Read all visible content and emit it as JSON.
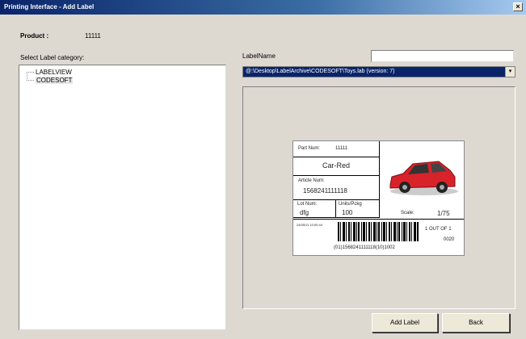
{
  "window": {
    "title": "Printing Interface - Add Label",
    "close_glyph": "×"
  },
  "product": {
    "label": "Product :",
    "value": "11111"
  },
  "category": {
    "label": "Select Label category:",
    "items": [
      {
        "label": "LABELVIEW",
        "selected": false
      },
      {
        "label": "CODESOFT",
        "selected": true
      }
    ]
  },
  "label_name": {
    "label": "LabelName",
    "value": ""
  },
  "label_path": {
    "value": "@:\\Desktop\\LabelArchive\\CODESOFT\\Toys.lab (version: 7)",
    "arrow_glyph": "▾"
  },
  "preview": {
    "part_num_label": "Part Num:",
    "part_num_value": "11111",
    "product_name": "Car-Red",
    "article_num_label": "Article Num:",
    "article_num_value": "1568241111118",
    "lot_num_label": "Lot Num:",
    "lot_num_value": "dfg",
    "units_label": "Units/Pckg",
    "units_value": "100",
    "scale_label": "Scale:",
    "scale_value": "1/75",
    "timestamp": "24/05/11 10:00:44",
    "count_text": "1 OUT OF 1",
    "serial": "0020",
    "barcode_text": "(01)1568241111118(10)1002",
    "car_color": "#d8232a"
  },
  "buttons": {
    "add_label": "Add Label",
    "back": "Back"
  },
  "colors": {
    "titlebar_start": "#0a246a",
    "titlebar_end": "#a6caf0",
    "dialog_bg": "#ddd9d1",
    "selection": "#0a246a"
  }
}
